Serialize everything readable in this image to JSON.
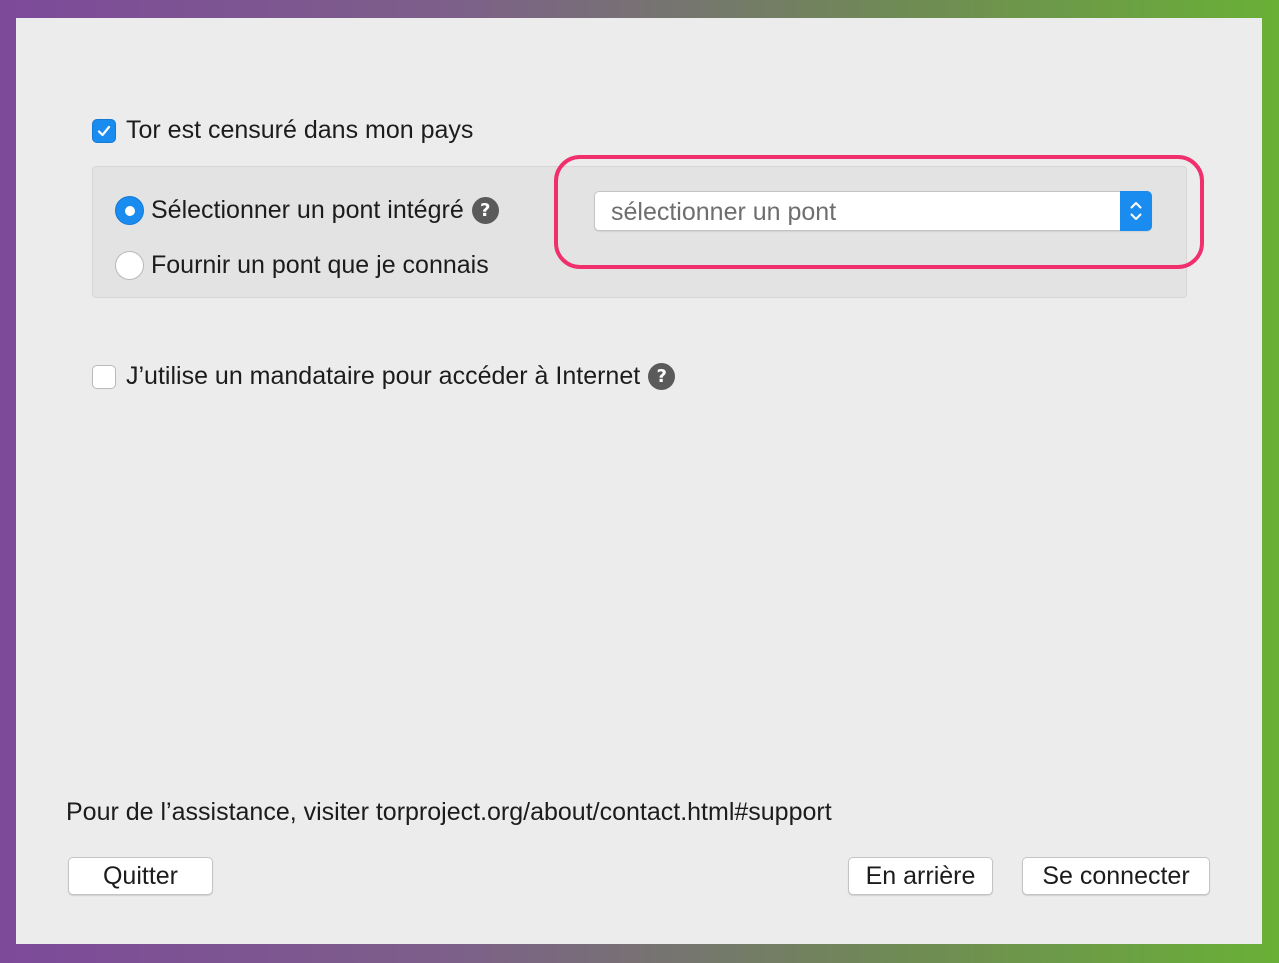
{
  "options": {
    "censored": {
      "label": "Tor est censuré dans mon pays",
      "checked": true
    },
    "bridge_choice": {
      "builtin_label": "Sélectionner un pont intégré",
      "custom_label": "Fournir un pont que je connais",
      "selected": "builtin"
    },
    "bridge_select": {
      "value": "sélectionner un pont"
    },
    "proxy": {
      "label": "J’utilise un mandataire pour accéder à Internet",
      "checked": false
    }
  },
  "help_icon_glyph": "?",
  "support_text": "Pour de l’assistance, visiter torproject.org/about/contact.html#support",
  "buttons": {
    "quit": "Quitter",
    "back": "En arrière",
    "connect": "Se connecter"
  },
  "colors": {
    "accent": "#1a8cf0",
    "highlight": "#f0306c",
    "window_bg": "#ececec"
  }
}
